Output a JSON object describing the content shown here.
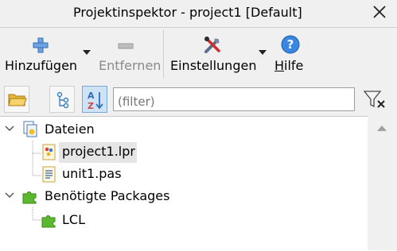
{
  "window": {
    "title": "Projektinspektor - project1 [Default]"
  },
  "toolbar": {
    "add_label": "Hinzufügen",
    "remove_label": "Entfernen",
    "settings_label": "Einstellungen",
    "help_label_accel": "H",
    "help_label_rest": "ilfe"
  },
  "filter": {
    "placeholder": "(filter)"
  },
  "tree": {
    "files_label": "Dateien",
    "file1": "project1.lpr",
    "file2": "unit1.pas",
    "packages_label": "Benötigte Packages",
    "package1": "LCL"
  },
  "colors": {
    "accent": "#2f7fd6",
    "green_icon": "#5cb82e",
    "disabled": "#8a8a8a"
  }
}
